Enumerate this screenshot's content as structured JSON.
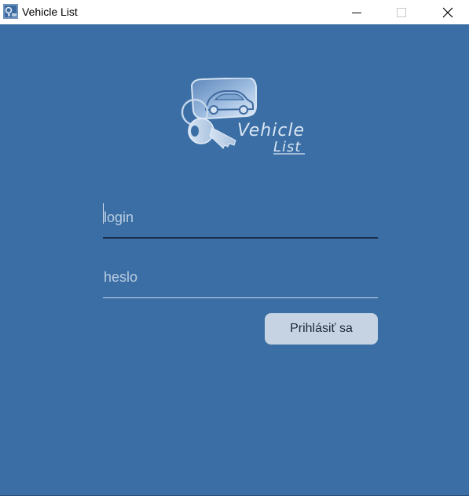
{
  "window": {
    "title": "Vehicle List"
  },
  "titlebar": {
    "icons": {
      "app": "vehicle-list-app-icon",
      "minimize": "minimize-icon",
      "maximize": "maximize-icon",
      "close": "close-icon"
    }
  },
  "logo": {
    "icon": "car-key-logo",
    "text_line1": "Vehicle",
    "text_line2": "List"
  },
  "form": {
    "login": {
      "value": "",
      "placeholder": "login"
    },
    "password": {
      "value": "",
      "placeholder": "heslo"
    },
    "submit_label": "Prihlásiť sa"
  },
  "colors": {
    "background": "#3a6ea5",
    "button": "#c5d3e3",
    "titlebar": "#ffffff"
  }
}
